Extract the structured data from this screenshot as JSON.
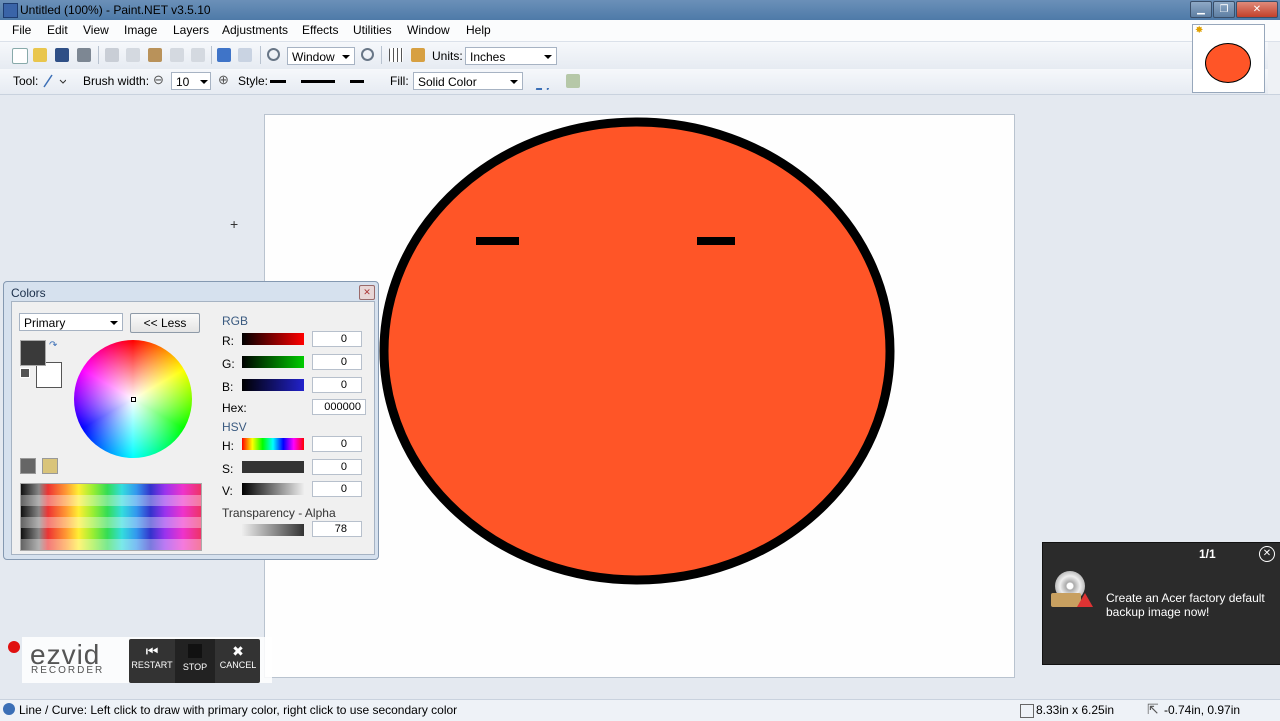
{
  "window": {
    "title": "Untitled (100%) - Paint.NET v3.5.10",
    "minimize": "▁",
    "maximize": "❐",
    "close": "✕"
  },
  "menu": [
    "File",
    "Edit",
    "View",
    "Image",
    "Layers",
    "Adjustments",
    "Effects",
    "Utilities",
    "Window",
    "Help"
  ],
  "toolbar": {
    "zoom_value": "Window",
    "units_label": "Units:",
    "units_value": "Inches",
    "tool_label": "Tool:",
    "brush_width_label": "Brush width:",
    "brush_width_value": "10",
    "style_label": "Style:",
    "fill_label": "Fill:",
    "fill_value": "Solid Color"
  },
  "colors_panel": {
    "title": "Colors",
    "mode": "Primary",
    "less_button": "<< Less",
    "rgb_label": "RGB",
    "r_label": "R:",
    "r_value": "0",
    "g_label": "G:",
    "g_value": "0",
    "b_label": "B:",
    "b_value": "0",
    "hex_label": "Hex:",
    "hex_value": "000000",
    "hsv_label": "HSV",
    "h_label": "H:",
    "h_value": "0",
    "s_label": "S:",
    "s_value": "0",
    "v_label": "V:",
    "v_value": "0",
    "alpha_label": "Transparency - Alpha",
    "alpha_value": "78"
  },
  "ezvid": {
    "brand": "ezvid",
    "sub": "RECORDER",
    "restart": "RESTART",
    "stop": "STOP",
    "cancel": "CANCEL"
  },
  "notification": {
    "count": "1/1",
    "message": "Create an Acer factory default backup image now!"
  },
  "status": {
    "hint": "Line / Curve: Left click to draw with primary color, right click to use secondary color",
    "image_size": "8.33in x 6.25in",
    "cursor_pos": "-0.74in, 0.97in"
  },
  "colors": {
    "face": "#ff5527",
    "outline": "#000000",
    "accent": "#4e7aa8"
  }
}
